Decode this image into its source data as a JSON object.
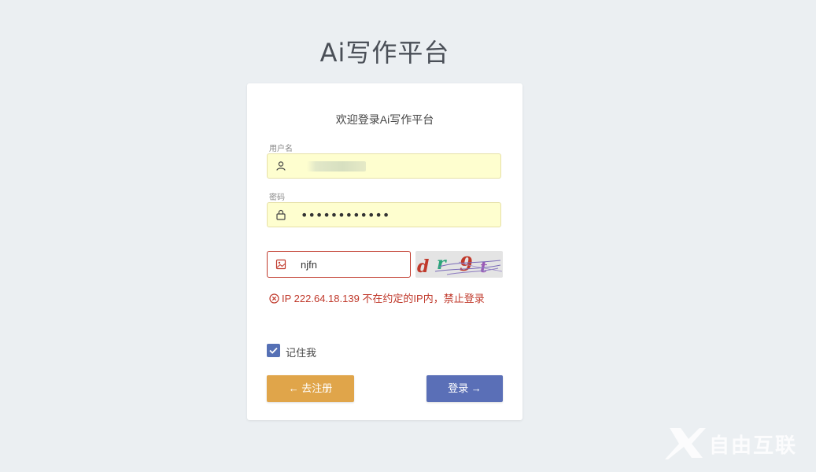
{
  "app": {
    "title": "Ai写作平台"
  },
  "login": {
    "welcome": "欢迎登录Ai写作平台",
    "username_label": "用户名",
    "username_value": "",
    "password_label": "密码",
    "password_value": "••••••••••••",
    "captcha_value": "njfn",
    "captcha_text": "dr9t",
    "error_message": "IP 222.64.18.139 不在约定的IP内，禁止登录",
    "remember_label": "记住我",
    "remember_checked": true,
    "register_button": "← 去注册",
    "login_button": "登录 →"
  },
  "icons": {
    "username": "user-icon",
    "password": "lock-icon",
    "captcha": "image-icon",
    "error": "error-circle-icon",
    "checkbox": "check-icon"
  },
  "colors": {
    "background": "#ebeff2",
    "register_button": "#e0a54a",
    "login_button": "#5a6fb7",
    "error": "#c0392b",
    "autofill": "#fefecf",
    "checkbox": "#5570b5"
  },
  "watermark": {
    "text": "自由互联"
  }
}
